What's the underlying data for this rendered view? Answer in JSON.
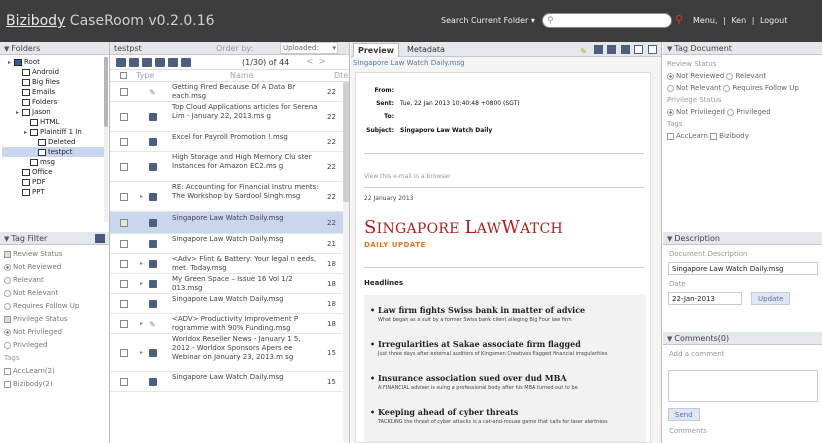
{
  "app": {
    "brand_link": "Bizibody",
    "brand_rest": " CaseRoom v0.2.0.16"
  },
  "topbar": {
    "scope_label": "Search Current Folder ▾",
    "search_placeholder": "",
    "menu_links": [
      "Menu,",
      "|",
      "Ken",
      "|",
      "Logout"
    ]
  },
  "folders": {
    "title": "Folders",
    "tree": [
      {
        "label": "Root",
        "depth": 0,
        "root": true
      },
      {
        "label": "Android",
        "depth": 1
      },
      {
        "label": "Big files",
        "depth": 1
      },
      {
        "label": "Emails",
        "depth": 1
      },
      {
        "label": "Folders",
        "depth": 1
      },
      {
        "label": "Jason",
        "depth": 1
      },
      {
        "label": "HTML",
        "depth": 2
      },
      {
        "label": "Plaintiff 1 In",
        "depth": 2
      },
      {
        "label": "Deleted",
        "depth": 3
      },
      {
        "label": "testpct",
        "depth": 3,
        "selected": true
      },
      {
        "label": "msg",
        "depth": 2
      },
      {
        "label": "Office",
        "depth": 1
      },
      {
        "label": "PDF",
        "depth": 1
      },
      {
        "label": "PPT",
        "depth": 1
      }
    ]
  },
  "tagfilter": {
    "title": "Tag Filter",
    "review_status": "Review Status",
    "options_review": [
      "Not Reviewed",
      "Relevant",
      "Not Relevant",
      "Requires Follow Up"
    ],
    "privilege_status": "Privilege Status",
    "options_privilege": [
      "Not Privileged",
      "Privileged"
    ],
    "tags_label": "Tags",
    "tags": [
      "AccLearn(2)",
      "Bizibody(2)"
    ]
  },
  "items": {
    "folder_name": "testpst",
    "order_by": "Order by:",
    "order_value": "Uploaded:",
    "count": "(1/30) of 44",
    "pager_prev": "<",
    "pager_next": ">",
    "col_type": "Type",
    "col_name": "Name",
    "col_date": "Dte",
    "rows": [
      {
        "name": "Getting Fired Because Of A Data Br each.msg",
        "date": "22",
        "icon": "clip",
        "h": 20
      },
      {
        "name": "Top Cloud Applications articles for Serena Lim - January 22, 2013.ms g",
        "date": "22",
        "icon": "doc",
        "h": 30
      },
      {
        "name": "Excel for Payroll Promotion !.msg",
        "date": "22",
        "icon": "doc",
        "h": 20
      },
      {
        "name": "High Storage and High Memory Clu ster Instances for Amazon EC2.ms g",
        "date": "22",
        "icon": "doc",
        "h": 30
      },
      {
        "name": "RE: Accounting for Financial Instru ments: The Workshop by Sardool Singh.msg",
        "date": "22",
        "icon": "doc",
        "tri": true,
        "h": 30
      },
      {
        "name": "Singapore Law Watch Daily.msg",
        "date": "22",
        "icon": "doc",
        "selected": true,
        "checked": true,
        "h": 22
      },
      {
        "name": "Singapore Law Watch Daily.msg",
        "date": "21",
        "icon": "doc",
        "h": 20
      },
      {
        "name": "<Adv> Flint & Battery: Your legal n eeds, met. Today.msg",
        "date": "18",
        "icon": "doc",
        "tri": true,
        "h": 20
      },
      {
        "name": "My Green Space – Issue 16 Vol 1/2 013.msg",
        "date": "18",
        "icon": "doc",
        "tri": true,
        "h": 20
      },
      {
        "name": "Singapore Law Watch Daily.msg",
        "date": "18",
        "icon": "doc",
        "h": 20
      },
      {
        "name": "<ADV> Productivity Improvement P rogramme with 90% Funding.msg",
        "date": "18",
        "icon": "clip",
        "tri": true,
        "h": 20
      },
      {
        "name": "Worldox Reseller News - January 1 5, 2012 - Worldox Sponsors Apers ee Webinar on January 23, 2013.m sg",
        "date": "15",
        "icon": "doc",
        "tri": true,
        "h": 38
      },
      {
        "name": "Singapore Law Watch Daily.msg",
        "date": "15",
        "icon": "doc",
        "h": 20
      }
    ]
  },
  "preview": {
    "tab_preview": "Preview",
    "tab_metadata": "Metadata",
    "doc_title": "Singapore Law Watch Daily.msg",
    "from_k": "From:",
    "from_v": "",
    "sent_k": "Sent:",
    "sent_v": "Tue, 22 Jan 2013 10:40:48 +0800 (SGT)",
    "to_k": "To:",
    "to_v": "",
    "subject_k": "Subject:",
    "subject_v": "Singapore Law Watch Daily",
    "browser_link": "View this e-mail in a browser",
    "date": "22 January 2013",
    "mast_1": "S",
    "mast_2": "INGAPORE ",
    "mast_3": "L",
    "mast_4": "AW",
    "mast_5": "W",
    "mast_6": "ATCH",
    "daily_update": "DAILY UPDATE",
    "headlines_label": "Headlines",
    "headlines": [
      {
        "title": "Law firm fights Swiss bank in matter of advice",
        "sub": "What began as a suit by a former Swiss bank client alleging Big Four law firm"
      },
      {
        "title": "Irregularities at Sakae associate firm flagged",
        "sub": "Just three days after external auditors of Kingsmen Creatives flagged financial irregularities"
      },
      {
        "title": "Insurance association sued over dud MBA",
        "sub": "A FINANCIAL adviser is suing a professional body after his MBA turned out to be"
      },
      {
        "title": "Keeping ahead of cyber threats",
        "sub": "TACKLING the threat of cyber attacks is a cat-and-mouse game that calls for laser alertness"
      }
    ]
  },
  "tagdoc": {
    "title": "Tag Document",
    "review_status": "Review Status",
    "options_review": [
      "Not Reviewed",
      "Relevant",
      "Not Relevant",
      "Requires Follow Up"
    ],
    "privilege_status": "Privilege Status",
    "options_privilege": [
      "Not Privileged",
      "Privileged"
    ],
    "tags_label": "Tags",
    "tags": [
      "AccLearn",
      "Bizibody"
    ]
  },
  "description": {
    "title": "Description",
    "doc_desc_label": "Document Description",
    "doc_desc_value": "Singapore Law Watch Daily.msg",
    "date_label": "Date",
    "date_value": "22-Jan-2013",
    "update_label": "Update"
  },
  "comments": {
    "title": "Comments(0)",
    "add_label": "Add a comment",
    "send_label": "Send",
    "comments_label": "Comments"
  }
}
